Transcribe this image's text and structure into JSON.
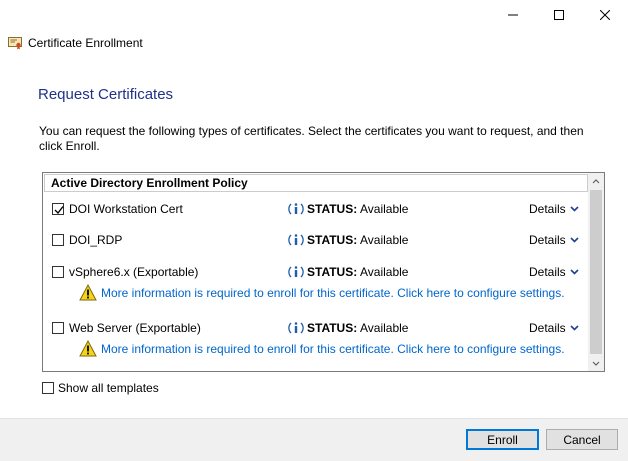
{
  "window": {
    "title": "Certificate Enrollment",
    "controls": [
      "minimize",
      "maximize",
      "close"
    ]
  },
  "page": {
    "heading": "Request Certificates",
    "description": "You can request the following types of certificates. Select the certificates you want to request, and then click Enroll."
  },
  "policy_group": {
    "header": "Active Directory Enrollment Policy"
  },
  "certificates": [
    {
      "name": "DOI Workstation Cert",
      "checked": true,
      "status_label": "STATUS:",
      "status_value": "Available",
      "details_label": "Details",
      "warning": ""
    },
    {
      "name": "DOI_RDP",
      "checked": false,
      "status_label": "STATUS:",
      "status_value": "Available",
      "details_label": "Details",
      "warning": ""
    },
    {
      "name": "vSphere6.x (Exportable)",
      "checked": false,
      "status_label": "STATUS:",
      "status_value": "Available",
      "details_label": "Details",
      "warning": "More information is required to enroll for this certificate. Click here to configure settings."
    },
    {
      "name": "Web Server (Exportable)",
      "checked": false,
      "status_label": "STATUS:",
      "status_value": "Available",
      "details_label": "Details",
      "warning": "More information is required to enroll for this certificate. Click here to configure settings."
    }
  ],
  "show_all_templates": {
    "label": "Show all templates",
    "checked": false
  },
  "footer": {
    "enroll_label": "Enroll",
    "cancel_label": "Cancel"
  },
  "colors": {
    "heading": "#1e3287",
    "link": "#0066cc",
    "primary_button_border": "#0078d7",
    "footer_bg": "#f0f0f0"
  },
  "icons": {
    "window": "certificate-icon",
    "status": "info-icon",
    "warning": "warning-icon",
    "details": "chevron-down-icon"
  }
}
